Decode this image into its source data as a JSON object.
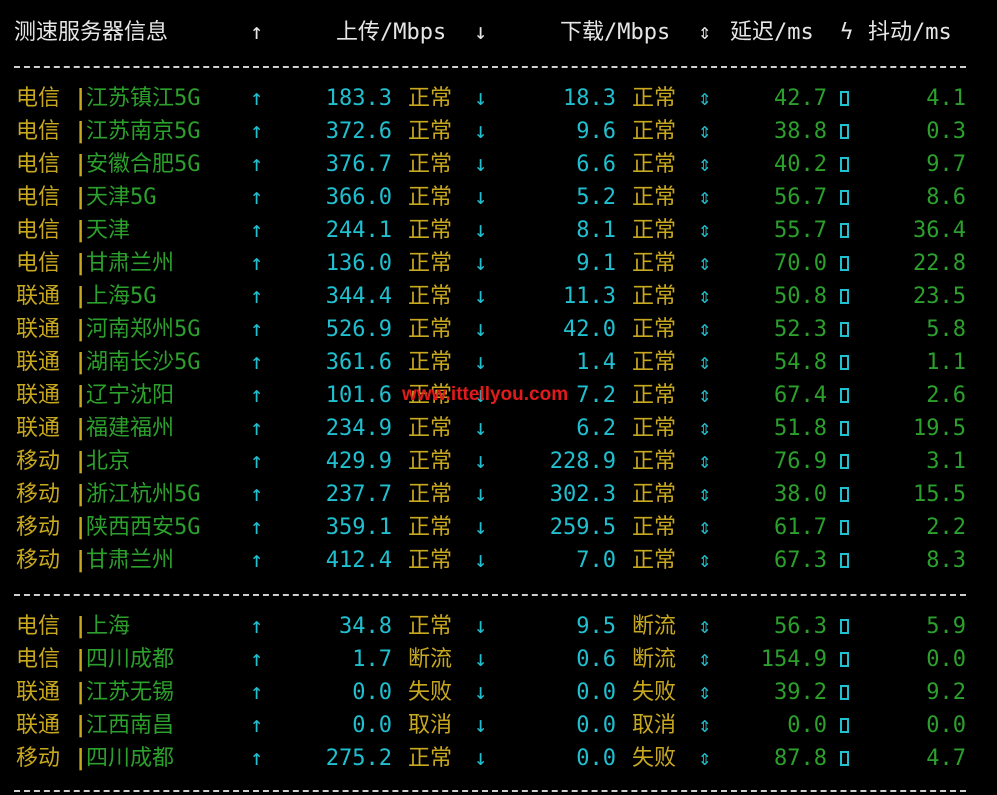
{
  "header": {
    "server_info": "测速服务器信息",
    "upload_arrow": "↑",
    "upload": "上传/Mbps",
    "download_arrow": "↓",
    "download": "下载/Mbps",
    "latency_arrow": "⇕",
    "latency": "延迟/ms",
    "jitter_arrow": "ϟ",
    "jitter": "抖动/ms"
  },
  "separator": "|",
  "watermark": "www.ittellyou.com",
  "groups": [
    {
      "rows": [
        {
          "isp": "电信",
          "node": "江苏镇江5G",
          "up": "183.3",
          "up_status": "正常",
          "down": "18.3",
          "down_status": "正常",
          "latency": "42.7",
          "jitter": "4.1"
        },
        {
          "isp": "电信",
          "node": "江苏南京5G",
          "up": "372.6",
          "up_status": "正常",
          "down": "9.6",
          "down_status": "正常",
          "latency": "38.8",
          "jitter": "0.3"
        },
        {
          "isp": "电信",
          "node": "安徽合肥5G",
          "up": "376.7",
          "up_status": "正常",
          "down": "6.6",
          "down_status": "正常",
          "latency": "40.2",
          "jitter": "9.7"
        },
        {
          "isp": "电信",
          "node": "天津5G",
          "up": "366.0",
          "up_status": "正常",
          "down": "5.2",
          "down_status": "正常",
          "latency": "56.7",
          "jitter": "8.6"
        },
        {
          "isp": "电信",
          "node": "天津",
          "up": "244.1",
          "up_status": "正常",
          "down": "8.1",
          "down_status": "正常",
          "latency": "55.7",
          "jitter": "36.4"
        },
        {
          "isp": "电信",
          "node": "甘肃兰州",
          "up": "136.0",
          "up_status": "正常",
          "down": "9.1",
          "down_status": "正常",
          "latency": "70.0",
          "jitter": "22.8"
        },
        {
          "isp": "联通",
          "node": "上海5G",
          "up": "344.4",
          "up_status": "正常",
          "down": "11.3",
          "down_status": "正常",
          "latency": "50.8",
          "jitter": "23.5"
        },
        {
          "isp": "联通",
          "node": "河南郑州5G",
          "up": "526.9",
          "up_status": "正常",
          "down": "42.0",
          "down_status": "正常",
          "latency": "52.3",
          "jitter": "5.8"
        },
        {
          "isp": "联通",
          "node": "湖南长沙5G",
          "up": "361.6",
          "up_status": "正常",
          "down": "1.4",
          "down_status": "正常",
          "latency": "54.8",
          "jitter": "1.1"
        },
        {
          "isp": "联通",
          "node": "辽宁沈阳",
          "up": "101.6",
          "up_status": "正常",
          "down": "7.2",
          "down_status": "正常",
          "latency": "67.4",
          "jitter": "2.6"
        },
        {
          "isp": "联通",
          "node": "福建福州",
          "up": "234.9",
          "up_status": "正常",
          "down": "6.2",
          "down_status": "正常",
          "latency": "51.8",
          "jitter": "19.5"
        },
        {
          "isp": "移动",
          "node": "北京",
          "up": "429.9",
          "up_status": "正常",
          "down": "228.9",
          "down_status": "正常",
          "latency": "76.9",
          "jitter": "3.1"
        },
        {
          "isp": "移动",
          "node": "浙江杭州5G",
          "up": "237.7",
          "up_status": "正常",
          "down": "302.3",
          "down_status": "正常",
          "latency": "38.0",
          "jitter": "15.5"
        },
        {
          "isp": "移动",
          "node": "陕西西安5G",
          "up": "359.1",
          "up_status": "正常",
          "down": "259.5",
          "down_status": "正常",
          "latency": "61.7",
          "jitter": "2.2"
        },
        {
          "isp": "移动",
          "node": "甘肃兰州",
          "up": "412.4",
          "up_status": "正常",
          "down": "7.0",
          "down_status": "正常",
          "latency": "67.3",
          "jitter": "8.3"
        }
      ]
    },
    {
      "rows": [
        {
          "isp": "电信",
          "node": "上海",
          "up": "34.8",
          "up_status": "正常",
          "down": "9.5",
          "down_status": "断流",
          "latency": "56.3",
          "jitter": "5.9"
        },
        {
          "isp": "电信",
          "node": "四川成都",
          "up": "1.7",
          "up_status": "断流",
          "down": "0.6",
          "down_status": "断流",
          "latency": "154.9",
          "jitter": "0.0"
        },
        {
          "isp": "联通",
          "node": "江苏无锡",
          "up": "0.0",
          "up_status": "失败",
          "down": "0.0",
          "down_status": "失败",
          "latency": "39.2",
          "jitter": "9.2"
        },
        {
          "isp": "联通",
          "node": "江西南昌",
          "up": "0.0",
          "up_status": "取消",
          "down": "0.0",
          "down_status": "取消",
          "latency": "0.0",
          "jitter": "0.0"
        },
        {
          "isp": "移动",
          "node": "四川成都",
          "up": "275.2",
          "up_status": "正常",
          "down": "0.0",
          "down_status": "失败",
          "latency": "87.8",
          "jitter": "4.7"
        }
      ]
    }
  ]
}
